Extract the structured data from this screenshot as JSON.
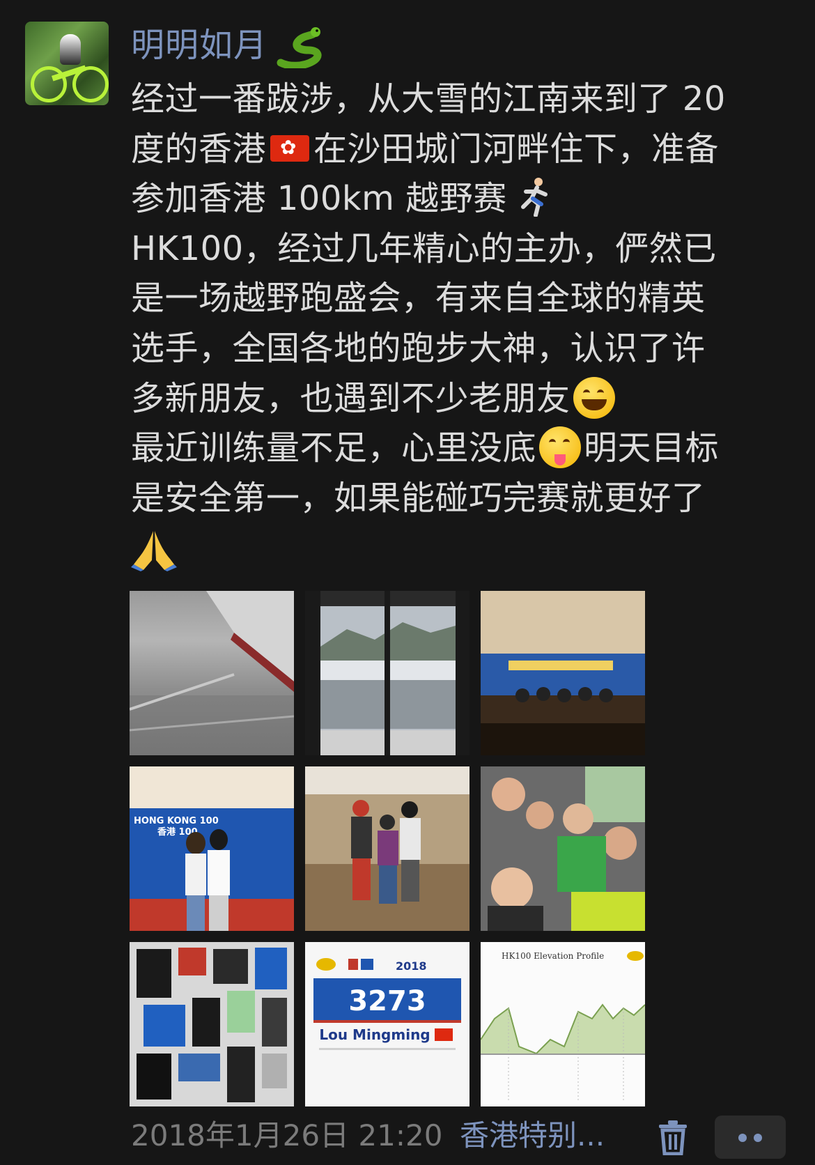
{
  "post": {
    "username": "明明如月",
    "lines": [
      "经过一番跋涉，从大雪的江南来到了 20",
      "度的香港",
      "在沙田城门河畔住下，准备",
      "参加香港 100km 越野赛",
      "HK100，经过几年精心的主办，俨然已",
      "是一场越野跑盛会，有来自全球的精英",
      "选手，全国各地的跑步大神，认识了许",
      "多新朋友，也遇到不少老朋友",
      "最近训练量不足，心里没底",
      "明天目标",
      "是安全第一，如果能碰巧完赛就更好了"
    ],
    "icons": {
      "snake": "snake-emoji",
      "flag": "hong-kong-flag-emoji",
      "runner": "runner-emoji",
      "grin": "grinning-face-emoji",
      "tongue": "squinting-tongue-face-emoji",
      "pray": "folded-hands-emoji"
    },
    "photos": {
      "bib_number": "3273",
      "bib_name": "Lou Mingming",
      "bib_year": "2018",
      "elevation_title": "HK100 Elevation Profile",
      "banner_text": "HONG KONG 100",
      "banner_text2": "香港 100"
    }
  },
  "footer": {
    "timestamp": "2018年1月26日 21:20",
    "location": "香港特别..."
  }
}
